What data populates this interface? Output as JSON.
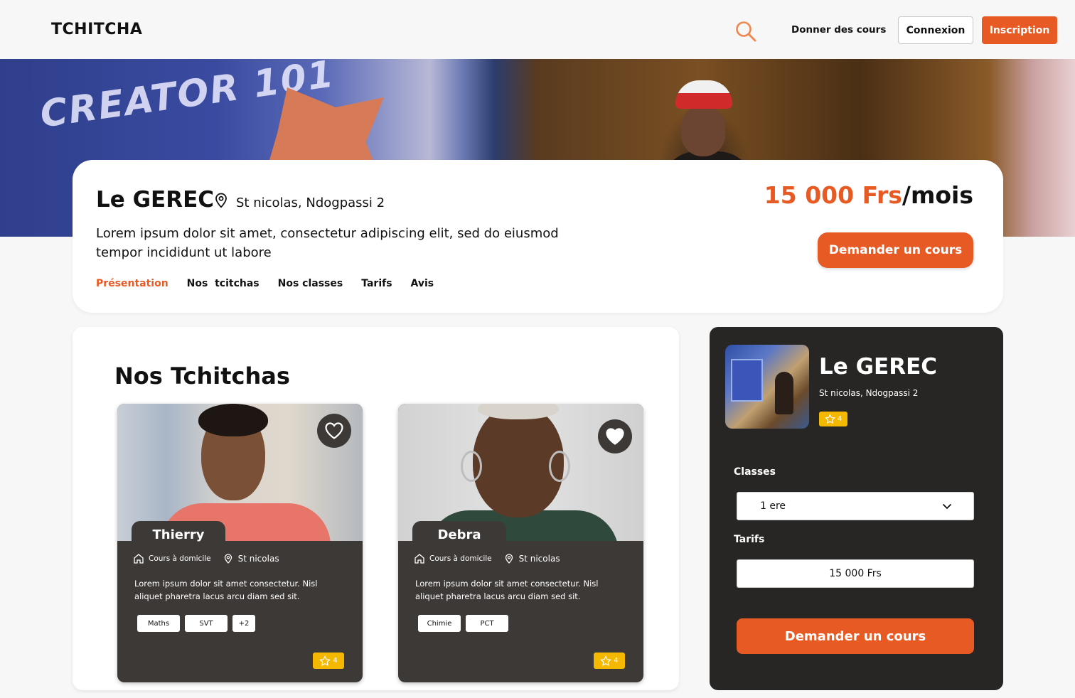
{
  "header": {
    "logo": "TCHITCHA",
    "teach_link": "Donner des cours",
    "login_label": "Connexion",
    "signup_label": "Inscription"
  },
  "hero": {
    "banner_text": "CREATOR 101"
  },
  "school": {
    "name": "Le GEREC",
    "location": "St nicolas, Ndogpassi 2",
    "description": "Lorem ipsum dolor sit amet, consectetur adipiscing elit, sed do eiusmod tempor incididunt ut labore",
    "price_amount": "15 000 Frs",
    "price_unit": "/mois",
    "request_label": "Demander un cours",
    "tabs": [
      "Présentation",
      "Nos  tcitchas",
      "Nos classes",
      "Tarifs",
      "Avis"
    ]
  },
  "tchitchas": {
    "title": "Nos Tchitchas",
    "cards": [
      {
        "name": "Thierry",
        "mode": "Cours à domicile",
        "location": "St nicolas",
        "description": "Lorem ipsum dolor sit amet consectetur. Nisl aliquet pharetra lacus arcu diam sed sit.",
        "subjects": [
          "Maths",
          "SVT",
          "+2"
        ],
        "rating": "4",
        "favorited": false
      },
      {
        "name": "Debra",
        "mode": "Cours à domicile",
        "location": "St nicolas",
        "description": "Lorem ipsum dolor sit amet consectetur. Nisl aliquet pharetra lacus arcu diam sed sit.",
        "subjects": [
          "Chimie",
          "PCT"
        ],
        "rating": "4",
        "favorited": true
      }
    ]
  },
  "booking": {
    "name": "Le GEREC",
    "location": "St nicolas, Ndogpassi 2",
    "rating": "4",
    "classes_label": "Classes",
    "class_selected": "1 ere",
    "tarifs_label": "Tarifs",
    "tarif_value": "15 000 Frs",
    "request_label": "Demander un cours"
  },
  "colors": {
    "accent": "#e85a24",
    "dark": "#3d3936",
    "panel_dark": "#282624",
    "rating": "#f5b800"
  },
  "icons": [
    "search-icon",
    "location-pin-icon",
    "heart-icon",
    "home-icon",
    "star-icon",
    "chevron-down-icon"
  ]
}
